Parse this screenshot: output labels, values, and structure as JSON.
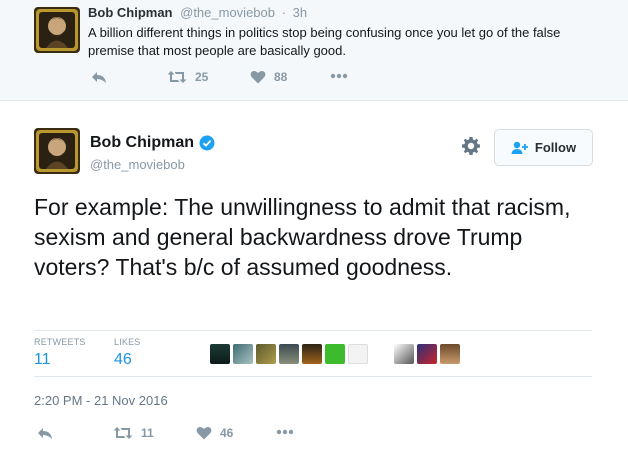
{
  "parent_tweet": {
    "name": "Bob Chipman",
    "handle": "@the_moviebob",
    "separator": "·",
    "time": "3h",
    "text": "A billion different things in politics stop being confusing once you let go of the false premise that most people are basically good.",
    "retweets": "25",
    "likes": "88"
  },
  "main_tweet": {
    "name": "Bob Chipman",
    "handle": "@the_moviebob",
    "follow_label": "Follow",
    "text": "For example: The unwillingness to admit that racism, sexism and general backwardness drove Trump voters? That's b/c of assumed goodness.",
    "stats": {
      "retweets_label": "RETWEETS",
      "retweets_value": "11",
      "likes_label": "LIKES",
      "likes_value": "46"
    },
    "timestamp": "2:20 PM - 21 Nov 2016",
    "action_retweets": "11",
    "action_likes": "46"
  },
  "icons": [
    "reply-icon",
    "retweet-icon",
    "heart-icon",
    "more-icon",
    "gear-icon",
    "follow-person-icon",
    "verified-badge-icon"
  ],
  "colors": {
    "accent": "#1b95e0",
    "muted": "#8899a6",
    "parent_bg": "#f5f8fa"
  }
}
